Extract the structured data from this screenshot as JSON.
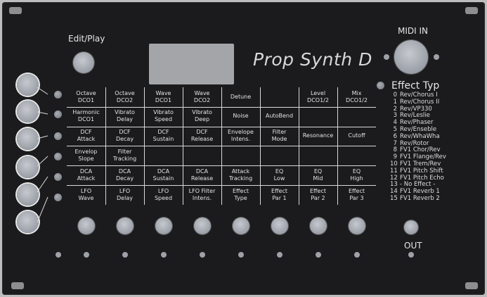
{
  "panel": {
    "title": "Prop Synth D",
    "edit_play_label": "Edit/Play",
    "midi_in_label": "MIDI IN",
    "out_label": "OUT"
  },
  "grid": {
    "rows": [
      [
        [
          "Octave",
          "DCO1"
        ],
        [
          "Octave",
          "DCO2"
        ],
        [
          "Wave",
          "DCO1"
        ],
        [
          "Wave",
          "DCO2"
        ],
        [
          "Detune",
          ""
        ],
        [
          "",
          ""
        ],
        [
          "Level",
          "DCO1/2"
        ],
        [
          "Mix",
          "DCO1/2"
        ]
      ],
      [
        [
          "Harmonic",
          "DCO1"
        ],
        [
          "Vibrato",
          "Delay"
        ],
        [
          "Vibrato",
          "Speed"
        ],
        [
          "Vibrato",
          "Deep"
        ],
        [
          "Noise",
          ""
        ],
        [
          "AutoBend",
          ""
        ],
        [
          "",
          ""
        ],
        [
          "",
          ""
        ]
      ],
      [
        [
          "DCF",
          "Attack"
        ],
        [
          "DCF",
          "Decay"
        ],
        [
          "DCF",
          "Sustain"
        ],
        [
          "DCF",
          "Release"
        ],
        [
          "Envelope",
          "Intens."
        ],
        [
          "Filter",
          "Mode"
        ],
        [
          "Resonance",
          ""
        ],
        [
          "Cutoff",
          ""
        ]
      ],
      [
        [
          "Envelop",
          "Slope"
        ],
        [
          "Filter",
          "Tracking"
        ],
        [
          "",
          ""
        ],
        [
          "",
          ""
        ],
        [
          "",
          ""
        ],
        [
          "",
          ""
        ],
        [
          "",
          ""
        ],
        [
          "",
          ""
        ]
      ],
      [
        [
          "DCA",
          "Attack"
        ],
        [
          "DCA",
          "Decay"
        ],
        [
          "DCA",
          "Sustain"
        ],
        [
          "DCA",
          "Release"
        ],
        [
          "Attack",
          "Tracking"
        ],
        [
          "EQ",
          "Low"
        ],
        [
          "EQ",
          "Mid"
        ],
        [
          "EQ",
          "High"
        ]
      ],
      [
        [
          "LFO",
          "Wave"
        ],
        [
          "LFO",
          "Delay"
        ],
        [
          "LFO",
          "Speed"
        ],
        [
          "LFO Filter",
          "Intens."
        ],
        [
          "Effect",
          "Type"
        ],
        [
          "Effect",
          "Par 1"
        ],
        [
          "Effect",
          "Par 2"
        ],
        [
          "Effect",
          "Par 3"
        ]
      ]
    ]
  },
  "effects": {
    "title": "Effect Typ",
    "items": [
      {
        "num": "0",
        "name": "Rev/Chorus I"
      },
      {
        "num": "1",
        "name": "Rev/Chorus II"
      },
      {
        "num": "2",
        "name": "Rev/VP330"
      },
      {
        "num": "3",
        "name": "Rev/Leslie"
      },
      {
        "num": "4",
        "name": "Rev/Phaser"
      },
      {
        "num": "5",
        "name": "Rev/Enseble"
      },
      {
        "num": "6",
        "name": "Rev/WhaWha"
      },
      {
        "num": "7",
        "name": "Rev/Rotor"
      },
      {
        "num": "8",
        "name": "FV1 Chor/Rev"
      },
      {
        "num": "9",
        "name": "FV1 Flange/Rev"
      },
      {
        "num": "10",
        "name": "FV1 Trem/Rev"
      },
      {
        "num": "11",
        "name": "FV1 Pitch Shift"
      },
      {
        "num": "12",
        "name": "FV1 Pitch Echo"
      },
      {
        "num": "13",
        "name": "- No Effect -"
      },
      {
        "num": "14",
        "name": "FV1 Reverb 1"
      },
      {
        "num": "15",
        "name": "FV1 Reverb 2"
      }
    ]
  }
}
